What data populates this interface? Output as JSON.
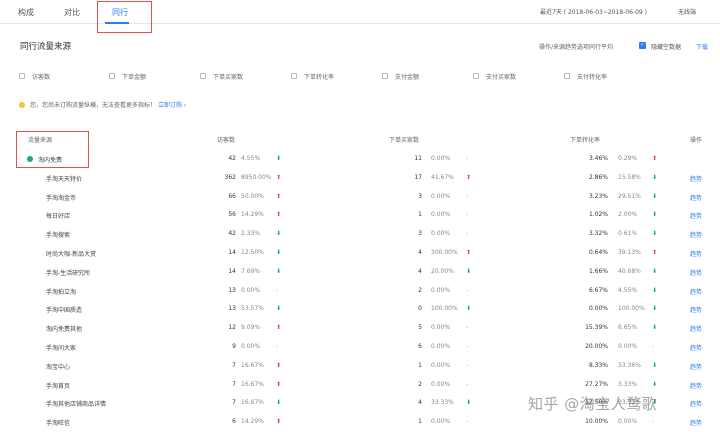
{
  "tabs": [
    {
      "label": "构成",
      "active": false
    },
    {
      "label": "对比",
      "active": false
    },
    {
      "label": "同行",
      "active": true
    }
  ],
  "date_range": "最近7天 ( 2018-06-03~2018-06-09 )",
  "device_filter": "无线端",
  "section_title": "同行流量来源",
  "right_controls": {
    "dropdown_label": "操作/来源趋势选项同行平均",
    "check_label": "隐藏空数据",
    "download_label": "下载"
  },
  "metrics": [
    {
      "label": "访客数"
    },
    {
      "label": "下单金额"
    },
    {
      "label": "下单买家数"
    },
    {
      "label": "下单转化率"
    },
    {
      "label": "支付金额"
    },
    {
      "label": "支付买家数"
    },
    {
      "label": "支付转化率"
    }
  ],
  "notice": {
    "text": "您，您尚未订购流量纵横，无法查看更多指标！",
    "link": "立即订购 ›"
  },
  "table": {
    "headers": {
      "source": "流量来源",
      "visitors": "访客数",
      "buyers": "下单买家数",
      "conversion": "下单转化率",
      "action": "操作"
    },
    "rows": [
      {
        "name": "淘内免费",
        "indent": 0,
        "vis": "42",
        "visp": "4.55%",
        "visd": "down",
        "buy": "11",
        "buyp": "0.00%",
        "buyd": "flat",
        "cv": "3.46%",
        "cvp": "0.29%",
        "cvd": "up",
        "action": ""
      },
      {
        "name": "手淘天天特价",
        "indent": 1,
        "vis": "362",
        "visp": "8950.00%",
        "visd": "up",
        "buy": "17",
        "buyp": "41.67%",
        "buyd": "up",
        "cv": "2.86%",
        "cvp": "15.58%",
        "cvd": "down",
        "action": "趋势"
      },
      {
        "name": "手淘淘金币",
        "indent": 1,
        "vis": "66",
        "visp": "50.00%",
        "visd": "up",
        "buy": "3",
        "buyp": "0.00%",
        "buyd": "flat",
        "cv": "3.23%",
        "cvp": "29.51%",
        "cvd": "down",
        "action": "趋势"
      },
      {
        "name": "每日好店",
        "indent": 1,
        "vis": "56",
        "visp": "14.29%",
        "visd": "up",
        "buy": "1",
        "buyp": "0.00%",
        "buyd": "flat",
        "cv": "1.02%",
        "cvp": "2.00%",
        "cvd": "down",
        "action": "趋势"
      },
      {
        "name": "手淘搜索",
        "indent": 1,
        "vis": "42",
        "visp": "2.33%",
        "visd": "down",
        "buy": "3",
        "buyp": "0.00%",
        "buyd": "flat",
        "cv": "3.32%",
        "cvp": "0.61%",
        "cvd": "down",
        "action": "趋势"
      },
      {
        "name": "时尚大咖-新品大赏",
        "indent": 1,
        "vis": "14",
        "visp": "12.50%",
        "visd": "down",
        "buy": "4",
        "buyp": "300.00%",
        "buyd": "up",
        "cv": "0.64%",
        "cvp": "39.13%",
        "cvd": "up",
        "action": "趋势"
      },
      {
        "name": "手淘-生活研究所",
        "indent": 1,
        "vis": "14",
        "visp": "7.69%",
        "visd": "down",
        "buy": "4",
        "buyp": "20.00%",
        "buyd": "down",
        "cv": "1.66%",
        "cvp": "40.68%",
        "cvd": "down",
        "action": "趋势"
      },
      {
        "name": "手淘拍立淘",
        "indent": 1,
        "vis": "13",
        "visp": "0.00%",
        "visd": "flat",
        "buy": "2",
        "buyp": "0.00%",
        "buyd": "flat",
        "cv": "6.67%",
        "cvp": "4.55%",
        "cvd": "down",
        "action": "趋势"
      },
      {
        "name": "手淘中国质造",
        "indent": 1,
        "vis": "13",
        "visp": "53.57%",
        "visd": "down",
        "buy": "0",
        "buyp": "100.00%",
        "buyd": "down",
        "cv": "0.00%",
        "cvp": "100.00%",
        "cvd": "down",
        "action": "趋势"
      },
      {
        "name": "淘内免费其他",
        "indent": 1,
        "vis": "12",
        "visp": "9.09%",
        "visd": "up",
        "buy": "5",
        "buyp": "0.00%",
        "buyd": "flat",
        "cv": "15.39%",
        "cvp": "6.65%",
        "cvd": "down",
        "action": "趋势"
      },
      {
        "name": "手淘问大家",
        "indent": 1,
        "vis": "9",
        "visp": "0.00%",
        "visd": "flat",
        "buy": "6",
        "buyp": "0.00%",
        "buyd": "flat",
        "cv": "20.00%",
        "cvp": "0.00%",
        "cvd": "flat",
        "action": "趋势"
      },
      {
        "name": "淘宝中心",
        "indent": 1,
        "vis": "7",
        "visp": "16.67%",
        "visd": "up",
        "buy": "1",
        "buyp": "0.00%",
        "buyd": "flat",
        "cv": "8.33%",
        "cvp": "33.36%",
        "cvd": "down",
        "action": "趋势"
      },
      {
        "name": "手淘首页",
        "indent": 1,
        "vis": "7",
        "visp": "16.67%",
        "visd": "up",
        "buy": "2",
        "buyp": "0.00%",
        "buyd": "flat",
        "cv": "27.27%",
        "cvp": "3.33%",
        "cvd": "down",
        "action": "趋势"
      },
      {
        "name": "手淘其他店铺商品详情",
        "indent": 1,
        "vis": "7",
        "visp": "16.67%",
        "visd": "down",
        "buy": "4",
        "buyp": "33.33%",
        "buyd": "down",
        "cv": "12.50%",
        "cvp": "33.33%",
        "cvd": "down",
        "action": "趋势"
      },
      {
        "name": "手淘旺信",
        "indent": 1,
        "vis": "6",
        "visp": "14.29%",
        "visd": "up",
        "buy": "1",
        "buyp": "0.00%",
        "buyd": "flat",
        "cv": "10.00%",
        "cvp": "0.00%",
        "cvd": "flat",
        "action": "趋势"
      }
    ]
  },
  "watermark": "知乎 @淘宝人鹜歌"
}
